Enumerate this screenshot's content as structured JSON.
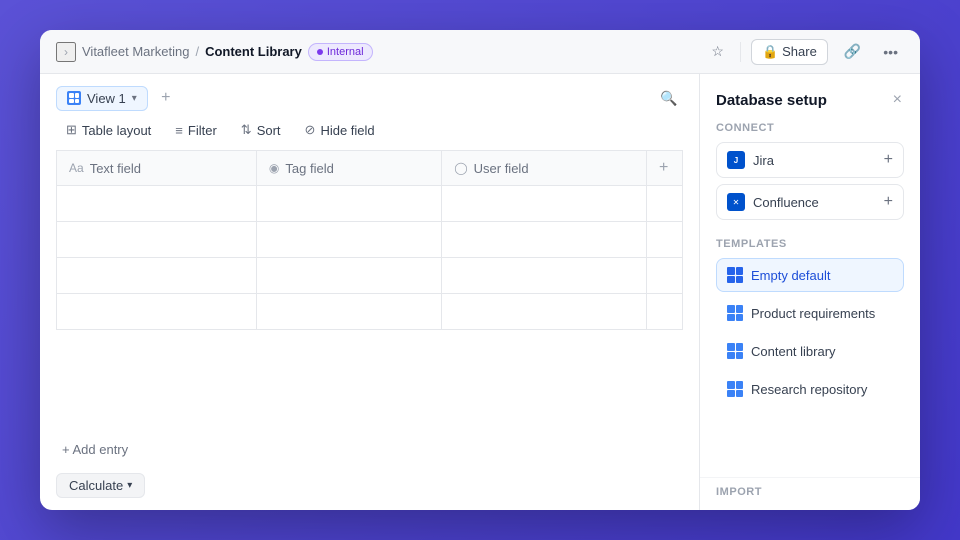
{
  "titlebar": {
    "collapse_icon": "›",
    "breadcrumb_parent": "Vitafleet Marketing",
    "breadcrumb_sep": "/",
    "breadcrumb_current": "Content Library",
    "badge_label": "Internal",
    "star_label": "★",
    "share_label": "Share",
    "link_icon": "🔗",
    "more_icon": "•••"
  },
  "toolbar": {
    "view_label": "View 1",
    "add_view_icon": "+",
    "search_icon": "🔍",
    "table_layout_label": "Table layout",
    "filter_label": "Filter",
    "sort_label": "Sort",
    "hide_field_label": "Hide field",
    "add_col_icon": "+"
  },
  "table": {
    "columns": [
      {
        "icon": "Aa",
        "label": "Text field"
      },
      {
        "icon": "◉",
        "label": "Tag field"
      },
      {
        "icon": "◯",
        "label": "User field"
      }
    ],
    "rows": [
      [
        "",
        "",
        ""
      ],
      [
        "",
        "",
        ""
      ],
      [
        "",
        "",
        ""
      ],
      [
        "",
        "",
        ""
      ]
    ]
  },
  "add_entry_label": "+ Add entry",
  "calculate_label": "Calculate",
  "right_panel": {
    "title": "Database setup",
    "close_icon": "×",
    "connect_label": "CONNECT",
    "connect_items": [
      {
        "name": "Jira",
        "icon": "J"
      },
      {
        "name": "Confluence",
        "icon": "C"
      }
    ],
    "templates_label": "TEMPLATES",
    "templates": [
      {
        "label": "Empty default",
        "active": true
      },
      {
        "label": "Product requirements",
        "active": false
      },
      {
        "label": "Content library",
        "active": false
      },
      {
        "label": "Research repository",
        "active": false
      }
    ],
    "import_label": "IMPORT"
  }
}
